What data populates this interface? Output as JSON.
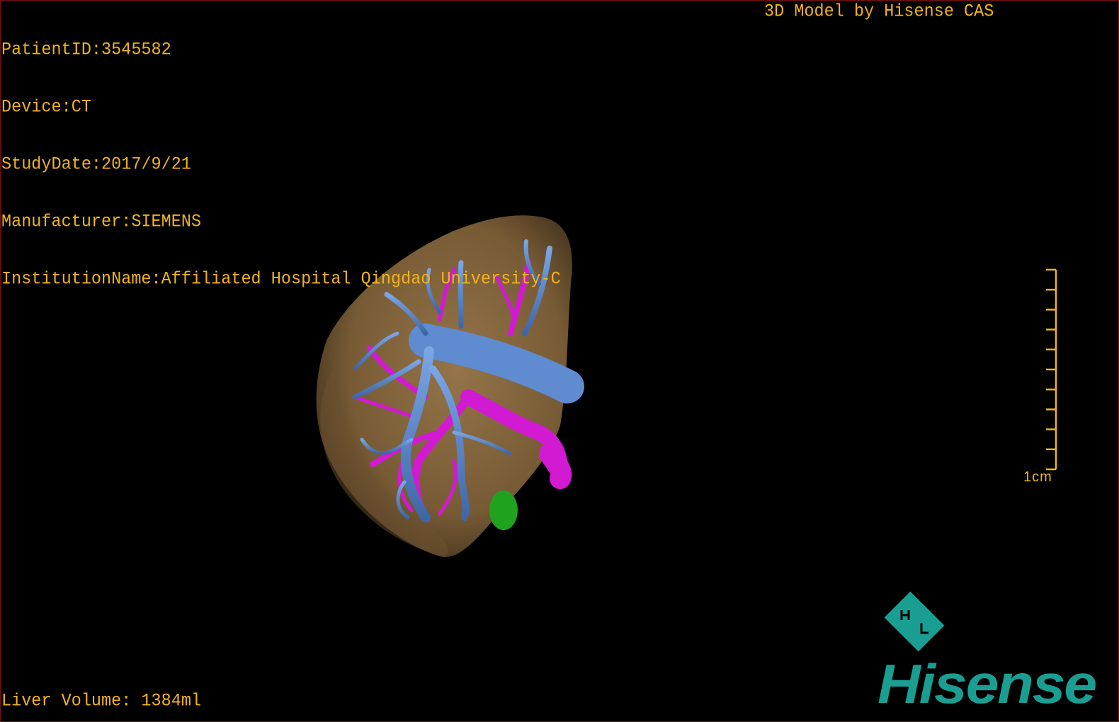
{
  "info": {
    "patient_id": "PatientID:3545582",
    "device": "Device:CT",
    "study_date": "StudyDate:2017/9/21",
    "manufacturer": "Manufacturer:SIEMENS",
    "institution": "InstitutionName:Affiliated Hospital Qingdao University-C"
  },
  "title": "3D Model by Hisense CAS",
  "volume": "Liver Volume: 1384ml",
  "scale_bar": {
    "label": "1cm",
    "ticks": 11
  },
  "logo": {
    "text": "Hisense",
    "color": "#1b9e92"
  },
  "colors": {
    "overlay_text": "#f2b31c",
    "liver": "#8a6a43",
    "hepatic_vein": "#5a86c8",
    "portal_vein": "#d21ad2",
    "lesion": "#1fa31f"
  }
}
